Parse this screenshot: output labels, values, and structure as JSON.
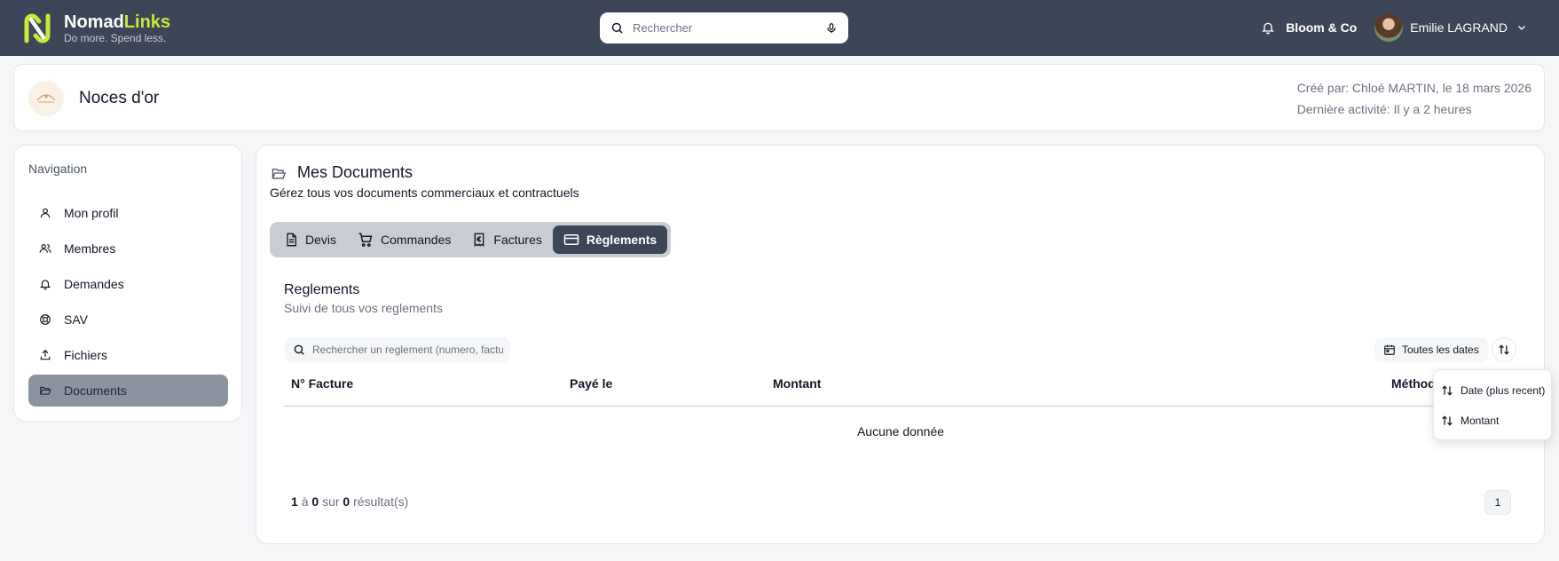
{
  "topbar": {
    "brand_part1": "Nomad",
    "brand_part2": "Links",
    "tagline": "Do more. Spend less.",
    "search_placeholder": "Rechercher",
    "company": "Bloom & Co",
    "user_name": "Emilie LAGRAND"
  },
  "project": {
    "title": "Noces d'or",
    "created": "Créé par: Chloé MARTIN, le 18 mars 2026",
    "last_activity": "Dernière activité: Il y a 2 heures"
  },
  "sidebar": {
    "title": "Navigation",
    "items": [
      {
        "label": "Mon profil",
        "icon": "user-icon"
      },
      {
        "label": "Membres",
        "icon": "users-icon"
      },
      {
        "label": "Demandes",
        "icon": "bell-icon"
      },
      {
        "label": "SAV",
        "icon": "lifebuoy-icon"
      },
      {
        "label": "Fichiers",
        "icon": "upload-icon"
      },
      {
        "label": "Documents",
        "icon": "folder-open-icon"
      }
    ],
    "active_index": 5
  },
  "main": {
    "title": "Mes Documents",
    "subtitle": "Gérez tous vos documents commerciaux et contractuels",
    "tabs": [
      {
        "label": "Devis",
        "icon": "file-text-icon"
      },
      {
        "label": "Commandes",
        "icon": "cart-icon"
      },
      {
        "label": "Factures",
        "icon": "euro-receipt-icon"
      },
      {
        "label": "Règlements",
        "icon": "credit-card-icon"
      }
    ],
    "active_tab": 3,
    "section_title": "Reglements",
    "section_subtitle": "Suivi de tous vos reglements",
    "table_search_placeholder": "Rechercher un reglement (numero, factu",
    "dates_filter": "Toutes les dates",
    "columns": [
      "N° Facture",
      "Payé le",
      "Montant",
      "Méthode"
    ],
    "empty_text": "Aucune donnée",
    "pagination": {
      "from": "1",
      "to_word": "à",
      "to": "0",
      "of_word": "sur",
      "total": "0",
      "suffix": "résultat(s)",
      "page": "1"
    },
    "sort_menu": [
      "Date (plus recent)",
      "Montant"
    ]
  },
  "colors": {
    "topbar": "#3d4658",
    "brand_accent": "#c8e83a",
    "active_nav": "#8a939f",
    "active_tab": "#3d4658"
  }
}
